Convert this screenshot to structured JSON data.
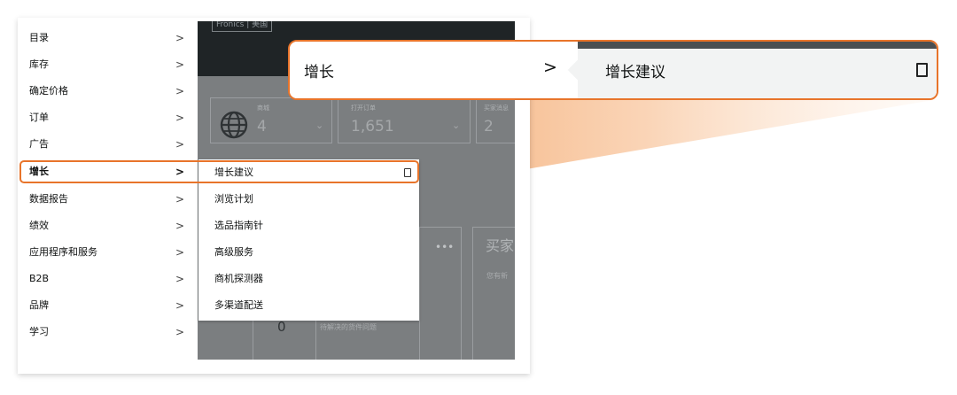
{
  "background_page": {
    "header_tag": "Fronics | 美国",
    "widgets": [
      {
        "small_label": "商城",
        "value": "4"
      },
      {
        "small_label": "打开订单",
        "value": "1,651"
      },
      {
        "small_label": "买家消息",
        "value": "2"
      }
    ],
    "card_title": "买家",
    "card_subtitle": "您有新",
    "issue_count": "0",
    "issue_label": "待解决的货件问题"
  },
  "main_menu": {
    "items": [
      {
        "label": "目录"
      },
      {
        "label": "库存"
      },
      {
        "label": "确定价格"
      },
      {
        "label": "订单"
      },
      {
        "label": "广告"
      },
      {
        "label": "增长"
      },
      {
        "label": "数据报告"
      },
      {
        "label": "绩效"
      },
      {
        "label": "应用程序和服务"
      },
      {
        "label": "B2B"
      },
      {
        "label": "品牌"
      },
      {
        "label": "学习"
      }
    ],
    "active_index": 5
  },
  "sub_menu": {
    "items": [
      {
        "label": "增长建议"
      },
      {
        "label": "浏览计划"
      },
      {
        "label": "选品指南针"
      },
      {
        "label": "高级服务"
      },
      {
        "label": "商机探测器"
      },
      {
        "label": "多渠道配送"
      }
    ]
  },
  "callout": {
    "left_label": "增长",
    "right_label": "增长建议"
  },
  "colors": {
    "highlight": "#e8742a",
    "overlay": "#7b7e80",
    "header": "#1f2426"
  },
  "icons": {
    "chevron": "chevron-right-icon",
    "bookmark": "bookmark-icon",
    "globe": "globe-icon"
  }
}
